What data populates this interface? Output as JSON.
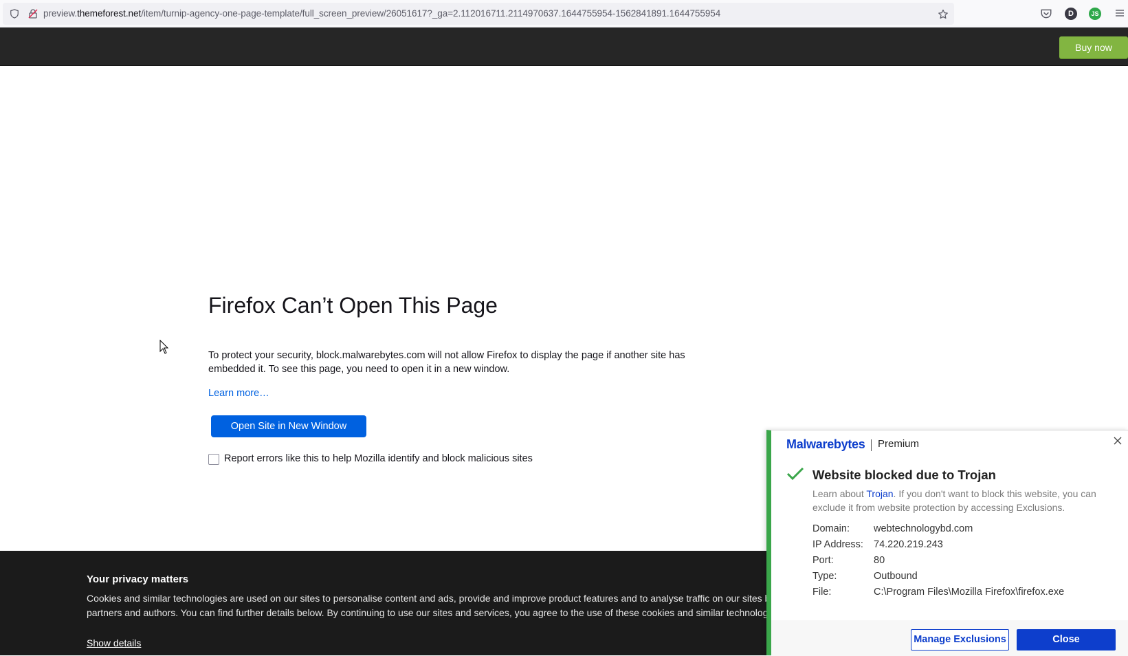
{
  "browser": {
    "url_host_prefix": "preview.",
    "url_host": "themeforest.net",
    "url_path": "/item/turnip-agency-one-page-template/full_screen_preview/26051617?_ga=2.112016711.2114970637.1644755954-1562841891.1644755954",
    "avatar_letter": "D",
    "extension_badge": "JS"
  },
  "topbar": {
    "buy_label": "Buy now"
  },
  "error": {
    "title": "Firefox Can’t Open This Page",
    "body": "To protect your security, block.malwarebytes.com will not allow Firefox to display the page if another site has embedded it. To see this page, you need to open it in a new window.",
    "learn_more": "Learn more…",
    "open_button": "Open Site in New Window",
    "report_label": "Report errors like this to help Mozilla identify and block malicious sites"
  },
  "privacy": {
    "title": "Your privacy matters",
    "line1": "Cookies and similar technologies are used on our sites to personalise content and ads, provide and improve product features and to analyse traffic on our sites by",
    "line2": "partners and authors. You can find further details below. By continuing to use our sites and services, you agree to the use of these cookies and similar technologie",
    "show_details": "Show details"
  },
  "malwarebytes": {
    "brand": "Malwarebytes",
    "tier": "Premium",
    "heading": "Website blocked due to Trojan",
    "desc_prefix": "Learn about ",
    "desc_link": "Trojan",
    "desc_suffix": ". If you don't want to block this website, you can exclude it from website protection by accessing Exclusions.",
    "details": [
      {
        "key": "Domain:",
        "value": "webtechnologybd.com"
      },
      {
        "key": "IP Address:",
        "value": "74.220.219.243"
      },
      {
        "key": "Port:",
        "value": "80"
      },
      {
        "key": "Type:",
        "value": "Outbound"
      },
      {
        "key": "File:",
        "value": "C:\\Program Files\\Mozilla Firefox\\firefox.exe"
      }
    ],
    "manage_label": "Manage Exclusions",
    "close_label": "Close",
    "accent_color": "#3aa64a",
    "brand_color": "#0d3ecc"
  }
}
